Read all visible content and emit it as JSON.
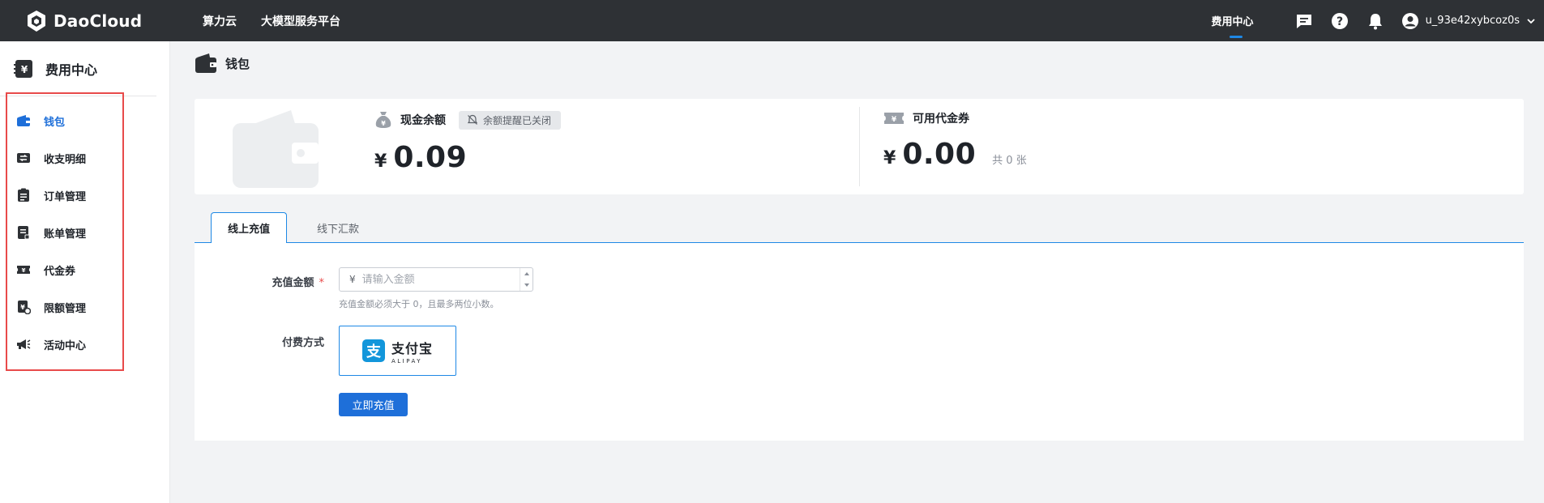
{
  "header": {
    "logo_text": "DaoCloud",
    "nav": [
      "算力云",
      "大模型服务平台"
    ],
    "billing_center": "费用中心",
    "username": "u_93e42xybcoz0s"
  },
  "sidebar": {
    "title": "费用中心",
    "items": [
      {
        "label": "钱包",
        "icon": "wallet-icon",
        "active": true
      },
      {
        "label": "收支明细",
        "icon": "transactions-icon"
      },
      {
        "label": "订单管理",
        "icon": "clipboard-icon"
      },
      {
        "label": "账单管理",
        "icon": "bill-icon"
      },
      {
        "label": "代金券",
        "icon": "coupon-icon"
      },
      {
        "label": "限额管理",
        "icon": "quota-icon"
      },
      {
        "label": "活动中心",
        "icon": "megaphone-icon"
      }
    ]
  },
  "page": {
    "title": "钱包"
  },
  "wallet": {
    "cash_label": "现金余额",
    "reminder_badge": "余额提醒已关闭",
    "currency": "¥",
    "cash_amount": "0.09",
    "coupon_label": "可用代金券",
    "coupon_amount": "0.00",
    "coupon_count": "共 0 张"
  },
  "tabs": {
    "online": "线上充值",
    "offline": "线下汇款"
  },
  "form": {
    "amount_label": "充值金额",
    "required_mark": "*",
    "currency_prefix": "¥",
    "amount_placeholder": "请输入金额",
    "amount_value": "",
    "hint": "充值金额必须大于 0，且最多两位小数。",
    "payment_label": "付费方式",
    "alipay_cn": "支付宝",
    "alipay_en": "ALIPAY",
    "submit_label": "立即充值"
  },
  "colors": {
    "topbar": "#2e3135",
    "accent": "#1e6fd9",
    "highlight_box": "#e84a4a",
    "alipay_blue": "#1296db"
  }
}
